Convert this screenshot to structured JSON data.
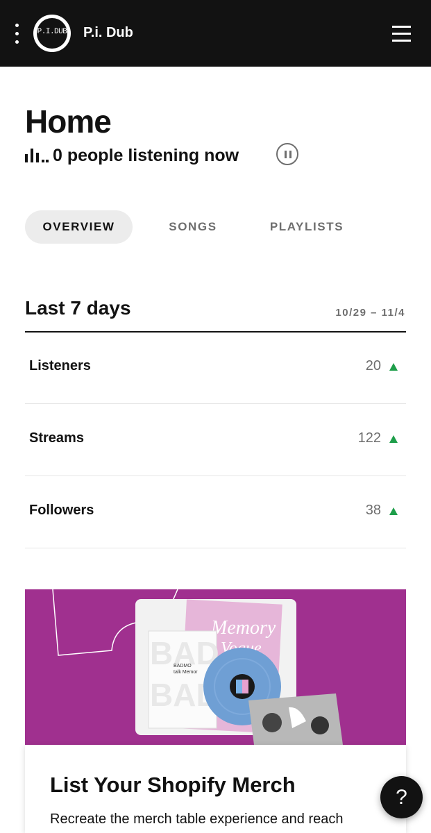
{
  "header": {
    "avatar_text": "P.I.DUB",
    "artist_name": "P.i. Dub",
    "more_icon": "kebab-menu-icon",
    "menu_icon": "hamburger-menu-icon"
  },
  "home": {
    "title": "Home",
    "listening_text": "0 people listening now",
    "listening_icon": "bar-graph-icon",
    "pause_icon": "pause-icon"
  },
  "tabs": [
    {
      "label": "OVERVIEW",
      "active": true
    },
    {
      "label": "SONGS",
      "active": false
    },
    {
      "label": "PLAYLISTS",
      "active": false
    }
  ],
  "stats": {
    "title": "Last 7 days",
    "range": "10/29 – 11/4",
    "rows": [
      {
        "label": "Listeners",
        "value": "20",
        "trend": "up"
      },
      {
        "label": "Streams",
        "value": "122",
        "trend": "up"
      },
      {
        "label": "Followers",
        "value": "38",
        "trend": "up"
      }
    ],
    "trend_color": "#1e9e4a"
  },
  "promo": {
    "banner_color": "#a0308f",
    "title": "List Your Shopify Merch",
    "description": "Recreate the merch table experience and reach",
    "art_text": [
      "BAD",
      "BAD",
      "Memory",
      "Vogue",
      "BADMO",
      "talk Memor"
    ]
  },
  "help": {
    "label": "?"
  },
  "colors": {
    "topbar": "#121212",
    "muted": "#6e6e6e",
    "tab_active_bg": "#ececec"
  }
}
